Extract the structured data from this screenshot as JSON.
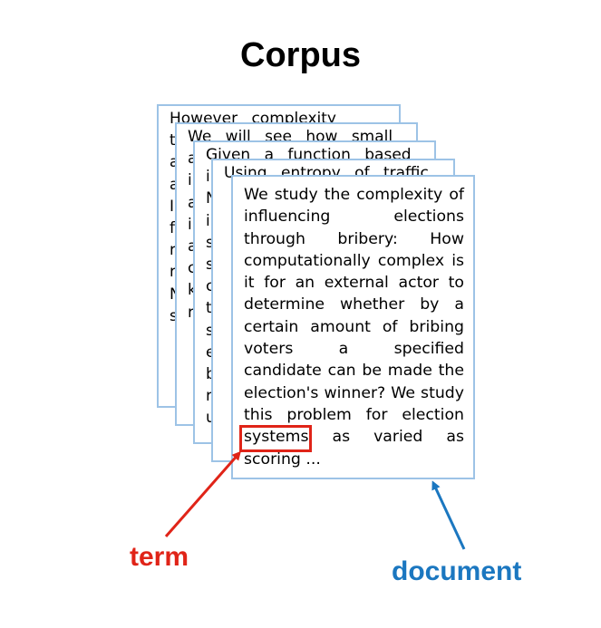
{
  "title": "Corpus",
  "documents": [
    {
      "first_line": "However complexity",
      "letters": [
        "t",
        "a",
        "a",
        "I",
        "f",
        "r",
        "r",
        "N",
        "s"
      ]
    },
    {
      "first_line": "We will see how small",
      "letters": [
        "a",
        "i",
        "a",
        "i",
        "a",
        "c",
        "k",
        "r"
      ]
    },
    {
      "first_line": "Given a function based",
      "letters": [
        "i",
        "N",
        "i",
        "s",
        "s",
        "c",
        "t",
        "s",
        "e",
        "b",
        "r",
        "u"
      ]
    },
    {
      "first_line": "Using entropy of traffic",
      "letters": [
        "",
        ""
      ]
    }
  ],
  "front_document_text": "We study the complexity of influencing elections through bribery: How computationally complex is it for an external actor to determine whether by a certain amount of bribing voters a specified candidate can be made the election's winner? We study this problem for election systems as varied as scoring ...",
  "labels": {
    "term": "term",
    "document": "document"
  },
  "colors": {
    "term": "#e02418",
    "document": "#1b77c0",
    "doc_border": "#9dc3e6"
  }
}
